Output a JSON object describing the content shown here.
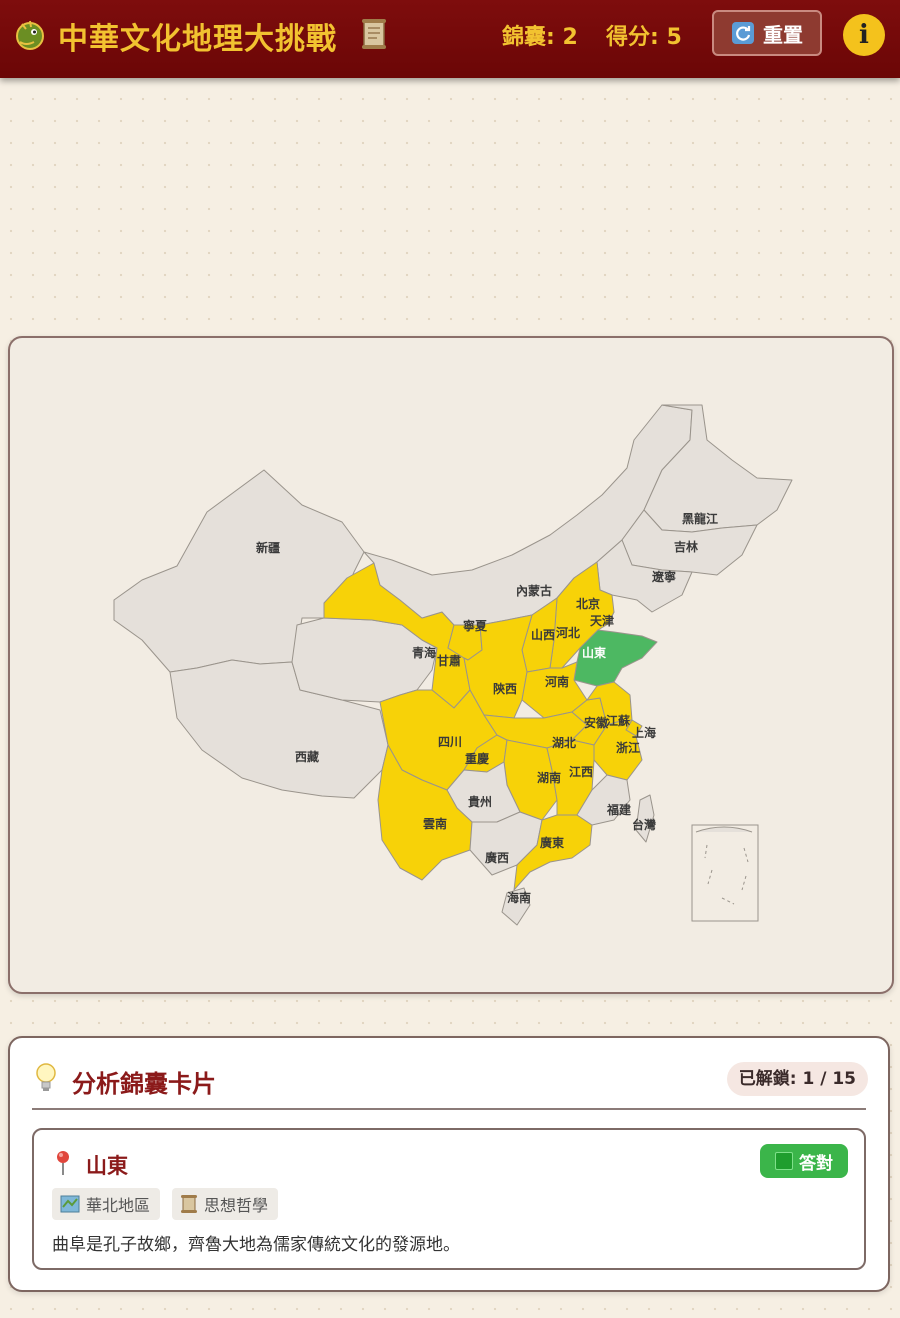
{
  "header": {
    "title": "中華文化地理大挑戰",
    "logo_icon": "dragon-icon",
    "title_icon": "scroll-icon",
    "bag_label": "錦囊: 2",
    "score_label": "得分: 5",
    "reset_label": "重置",
    "reset_icon": "refresh-icon",
    "info_label": "i"
  },
  "map": {
    "provinces": [
      {
        "name": "新疆",
        "state": "neutral"
      },
      {
        "name": "西藏",
        "state": "neutral"
      },
      {
        "name": "青海",
        "state": "neutral"
      },
      {
        "name": "甘肅",
        "state": "unlocked"
      },
      {
        "name": "寧夏",
        "state": "unlocked"
      },
      {
        "name": "內蒙古",
        "state": "neutral"
      },
      {
        "name": "黑龍江",
        "state": "neutral"
      },
      {
        "name": "吉林",
        "state": "neutral"
      },
      {
        "name": "遼寧",
        "state": "neutral"
      },
      {
        "name": "北京",
        "state": "unlocked"
      },
      {
        "name": "天津",
        "state": "unlocked"
      },
      {
        "name": "河北",
        "state": "unlocked"
      },
      {
        "name": "山西",
        "state": "unlocked"
      },
      {
        "name": "山東",
        "state": "selected"
      },
      {
        "name": "陝西",
        "state": "unlocked"
      },
      {
        "name": "河南",
        "state": "unlocked"
      },
      {
        "name": "四川",
        "state": "unlocked"
      },
      {
        "name": "重慶",
        "state": "unlocked"
      },
      {
        "name": "湖北",
        "state": "unlocked"
      },
      {
        "name": "安徽",
        "state": "unlocked"
      },
      {
        "name": "江蘇",
        "state": "unlocked"
      },
      {
        "name": "上海",
        "state": "unlocked"
      },
      {
        "name": "浙江",
        "state": "unlocked"
      },
      {
        "name": "湖南",
        "state": "unlocked"
      },
      {
        "name": "江西",
        "state": "unlocked"
      },
      {
        "name": "貴州",
        "state": "neutral"
      },
      {
        "name": "雲南",
        "state": "unlocked"
      },
      {
        "name": "廣西",
        "state": "neutral"
      },
      {
        "name": "廣東",
        "state": "unlocked"
      },
      {
        "name": "福建",
        "state": "neutral"
      },
      {
        "name": "台灣",
        "state": "neutral"
      },
      {
        "name": "海南",
        "state": "neutral"
      }
    ],
    "colors": {
      "neutral": "#e5e0da",
      "unlocked": "#f7d208",
      "selected": "#4db862",
      "border": "#9a948c"
    }
  },
  "panel": {
    "title": "分析錦囊卡片",
    "title_icon": "lightbulb-icon",
    "unlocked_label": "已解鎖: 1 / 15",
    "entry": {
      "name": "山東",
      "pin_icon": "map-pin-icon",
      "status": "答對",
      "tags": [
        {
          "icon": "map-icon",
          "label": "華北地區"
        },
        {
          "icon": "scroll-icon",
          "label": "思想哲學"
        }
      ],
      "description": "曲阜是孔子故鄉，齊魯大地為儒家傳統文化的發源地。"
    }
  }
}
